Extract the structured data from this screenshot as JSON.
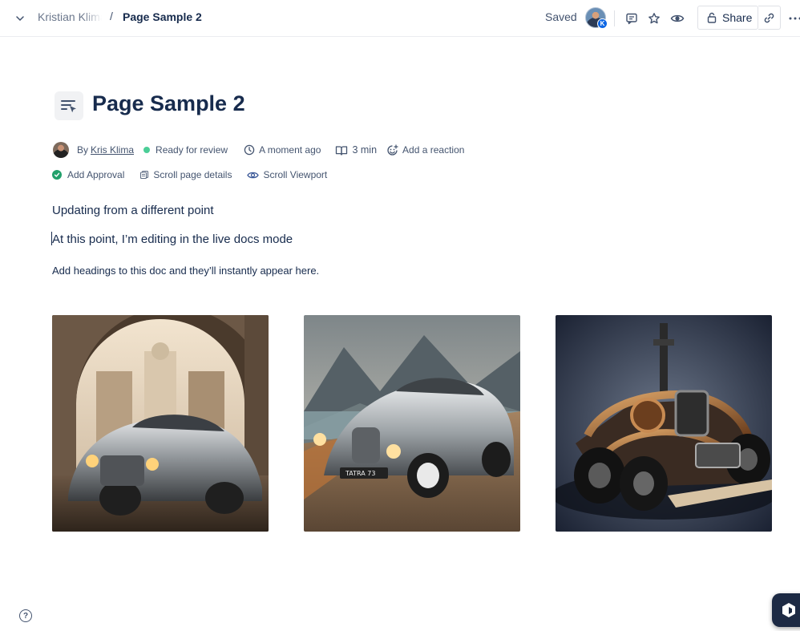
{
  "topbar": {
    "space_name": "Kristian Klima",
    "separator": "/",
    "page_name": "Page Sample 2",
    "saved_label": "Saved",
    "avatar_badge": "K",
    "share_label": "Share"
  },
  "page": {
    "title": "Page Sample 2",
    "byline": {
      "prefix": "By",
      "author": "Kris Klima",
      "status": "Ready for review",
      "updated": "A moment ago",
      "read_time": "3 min",
      "reaction_label": "Add a reaction"
    },
    "details": {
      "approval_label": "Add Approval",
      "scroll_details_label": "Scroll page details",
      "scroll_viewport_label": "Scroll Viewport"
    },
    "body": {
      "paragraph_1": "Updating from a different point",
      "paragraph_2": "At this point, I’m editing in the live docs mode",
      "paragraph_3": "Add headings to this doc and they’ll instantly appear here."
    },
    "images": [
      {
        "icon": "vintage-car-in-archway-image"
      },
      {
        "icon": "vintage-car-mountains-image",
        "plate": "TATRA 73"
      },
      {
        "icon": "steampunk-engine-car-image"
      }
    ]
  },
  "colors": {
    "status_green": "#4bce97",
    "approval_green": "#22a06b",
    "text_primary": "#172b4d",
    "text_secondary": "#44546f",
    "fab_dark": "#1d2a44"
  },
  "footer": {
    "help_label": "?"
  }
}
